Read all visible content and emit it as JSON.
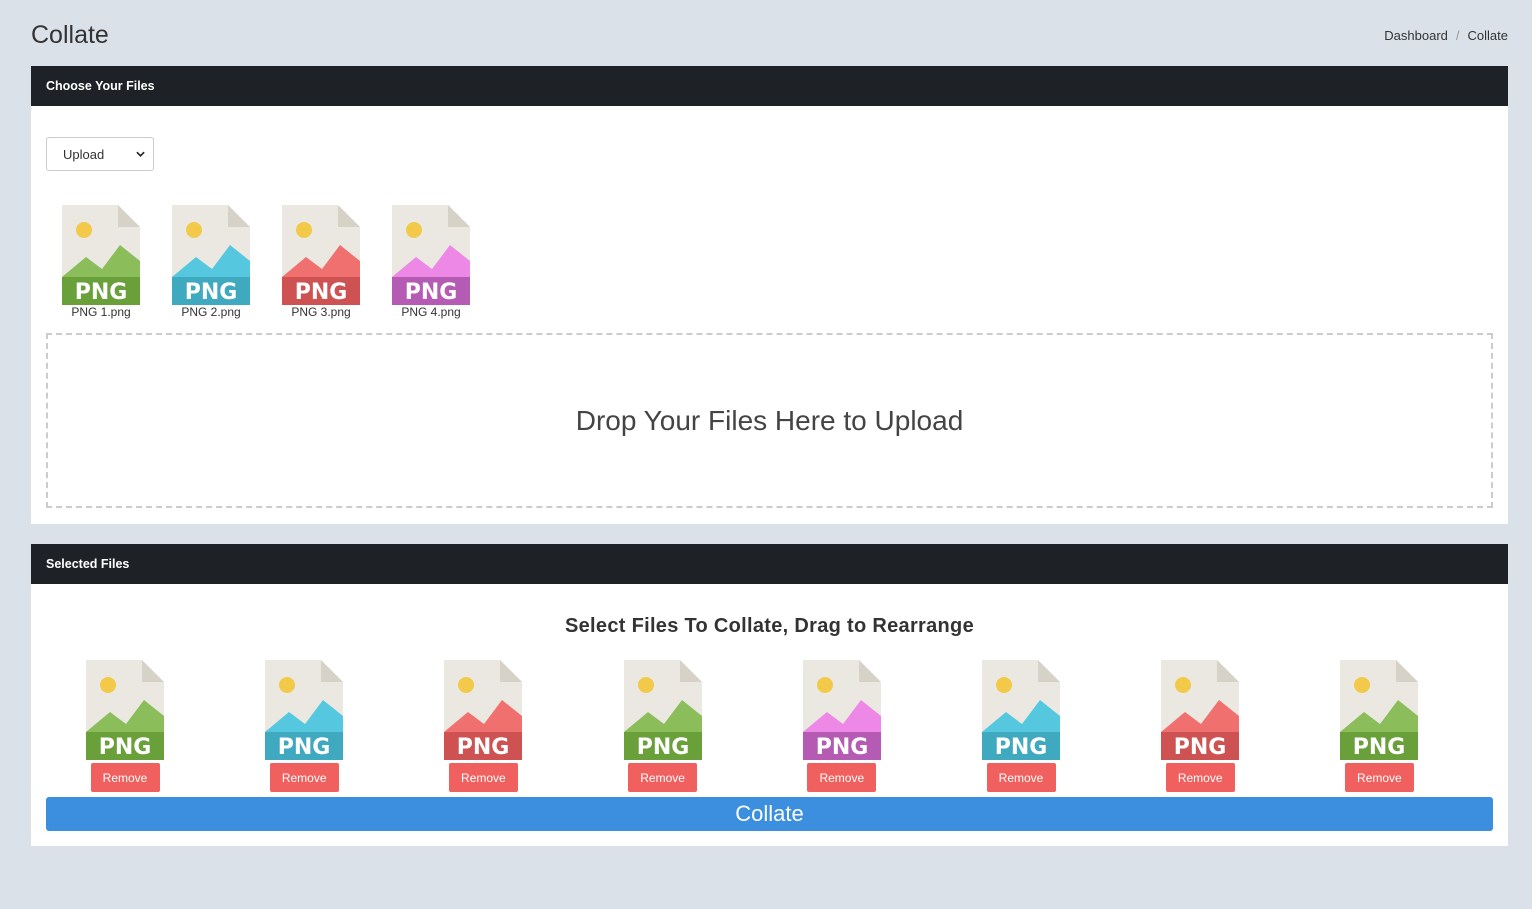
{
  "header": {
    "title": "Collate",
    "breadcrumb": [
      "Dashboard",
      "Collate"
    ],
    "breadcrumb_sep": "/"
  },
  "choose_card": {
    "title": "Choose Your Files",
    "source_select": {
      "selected": "Upload"
    },
    "files": [
      {
        "name": "PNG 1.png",
        "badge": "PNG",
        "color": "#8bbd5a",
        "band": "#6aa039"
      },
      {
        "name": "PNG 2.png",
        "badge": "PNG",
        "color": "#55c8e0",
        "band": "#3fa9bf"
      },
      {
        "name": "PNG 3.png",
        "badge": "PNG",
        "color": "#f07070",
        "band": "#cf5252"
      },
      {
        "name": "PNG 4.png",
        "badge": "PNG",
        "color": "#ee88e6",
        "band": "#b55bb3"
      }
    ],
    "drop_zone_text": "Drop Your Files Here to Upload"
  },
  "selected_card": {
    "title": "Selected Files",
    "subtitle": "Select Files To Collate, Drag to Rearrange",
    "remove_label": "Remove",
    "items": [
      {
        "badge": "PNG",
        "color": "#8bbd5a",
        "band": "#6aa039"
      },
      {
        "badge": "PNG",
        "color": "#55c8e0",
        "band": "#3fa9bf"
      },
      {
        "badge": "PNG",
        "color": "#f07070",
        "band": "#cf5252"
      },
      {
        "badge": "PNG",
        "color": "#8bbd5a",
        "band": "#6aa039"
      },
      {
        "badge": "PNG",
        "color": "#ee88e6",
        "band": "#b55bb3"
      },
      {
        "badge": "PNG",
        "color": "#55c8e0",
        "band": "#3fa9bf"
      },
      {
        "badge": "PNG",
        "color": "#f07070",
        "band": "#cf5252"
      },
      {
        "badge": "PNG",
        "color": "#8bbd5a",
        "band": "#6aa039"
      }
    ],
    "collate_label": "Collate"
  }
}
